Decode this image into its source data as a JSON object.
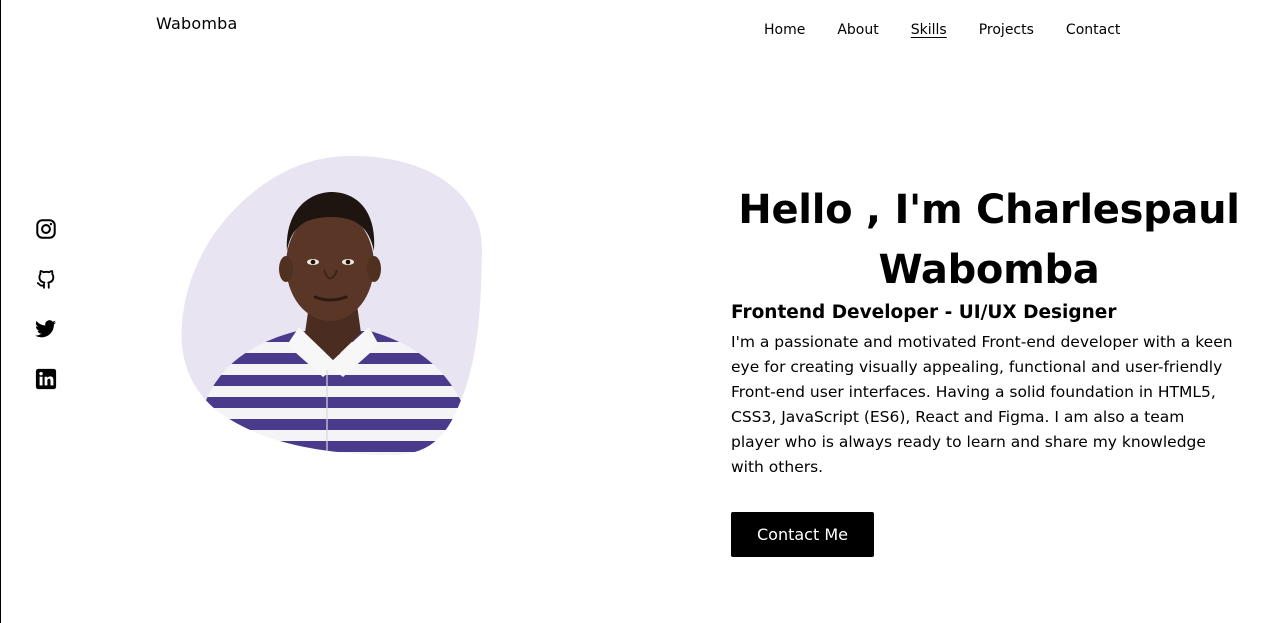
{
  "header": {
    "brand": "Wabomba",
    "nav": [
      {
        "label": "Home",
        "active": false
      },
      {
        "label": "About",
        "active": false
      },
      {
        "label": "Skills",
        "active": true
      },
      {
        "label": "Projects",
        "active": false
      },
      {
        "label": "Contact",
        "active": false
      }
    ]
  },
  "social": [
    {
      "icon": "instagram-icon"
    },
    {
      "icon": "github-icon"
    },
    {
      "icon": "twitter-icon"
    },
    {
      "icon": "linkedin-icon"
    }
  ],
  "hero": {
    "title": "Hello , I'm Charlespaul Wabomba",
    "subtitle": "Frontend Developer - UI/UX Designer",
    "bio": "I'm a passionate and motivated Front-end developer with a keen eye for creating visually appealing, functional and user-friendly Front-end user interfaces. Having a solid foundation in HTML5, CSS3, JavaScript (ES6), React and Figma. I am also a team player who is always ready to learn and share my knowledge with others.",
    "cta_label": "Contact Me"
  },
  "colors": {
    "background": "#ffffff",
    "text": "#000000",
    "portrait_backdrop": "#e8e4f2",
    "shirt_stripe": "#4a3a8c"
  }
}
